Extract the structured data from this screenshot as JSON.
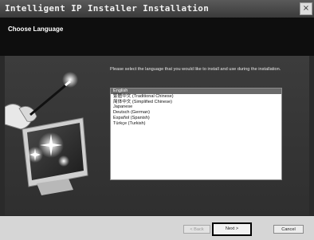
{
  "window": {
    "title": "Intelligent IP Installer Installation",
    "close_glyph": "×"
  },
  "header": {
    "title": "Choose Language"
  },
  "content": {
    "prompt": "Please select the language that you would like to install and use during the installation.",
    "languages": [
      {
        "label": "English",
        "selected": true
      },
      {
        "label": "繁體中文 (Traditional Chinese)",
        "selected": false
      },
      {
        "label": "简体中文 (Simplified Chinese)",
        "selected": false
      },
      {
        "label": "Japanese",
        "selected": false
      },
      {
        "label": "Deutsch (German)",
        "selected": false
      },
      {
        "label": "Español (Spanish)",
        "selected": false
      },
      {
        "label": "Türkçe (Turkish)",
        "selected": false
      }
    ]
  },
  "buttons": {
    "back": "< Back",
    "next": "Next >",
    "cancel": "Cancel"
  },
  "icons": {
    "close": "close-icon",
    "illustration": "monitor-wand-illustration"
  },
  "colors": {
    "selection": "#6a6a6a",
    "header_bg": "#0e0e0e",
    "panel_bg": "#333333"
  }
}
